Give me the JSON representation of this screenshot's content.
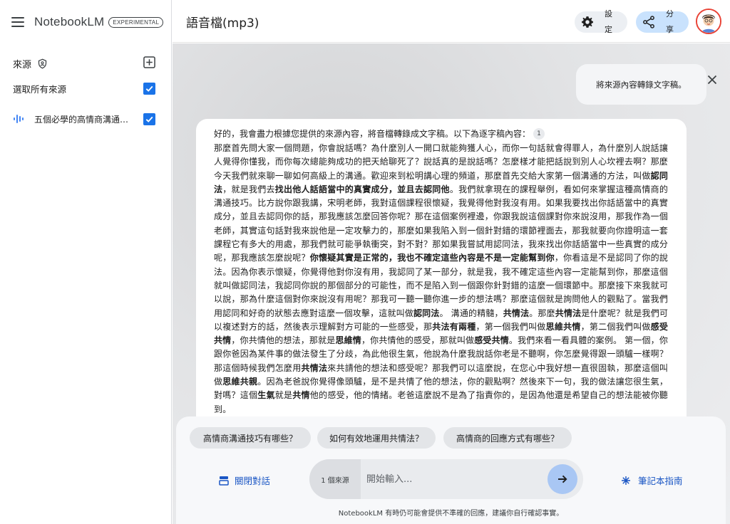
{
  "app": {
    "name": "NotebookLM",
    "badge": "EXPERIMENTAL"
  },
  "sidebar": {
    "sources_title": "來源",
    "select_all_label": "選取所有來源",
    "select_all_checked": true,
    "items": [
      {
        "icon": "audio-icon",
        "label": "五個必學的高情商溝通技巧",
        "checked": true
      }
    ]
  },
  "header": {
    "notebook_title": "語音檔(mp3)",
    "settings_label": "設定",
    "share_label": "分享"
  },
  "chat": {
    "user_message": "將來源內容轉錄文字稿。",
    "reply_intro": "好的，我會盡力根據您提供的來源內容，將音檔轉錄成文字稿。以下為逐字稿內容：",
    "citation": "1",
    "reply_segments": [
      {
        "t": "那麼首先問大家一個問題，你會說話嗎？為什麼別人一開口就能夠獲人心，而你一句話就會得罪人，為什麼別人說話讓人覺得你懂我，而你每次總能夠成功的把天給聊死了？說話真的是說話嗎？怎麼樣才能把話說到別人心坎裡去啊？那麼今天我們就來聊一聊如何高級上的溝通。歡迎來到松明講心理的頻道，那麼首先交給大家第一個溝通的方法，叫做",
        "b": false
      },
      {
        "t": "認同法",
        "b": true
      },
      {
        "t": "，就是我們去",
        "b": false
      },
      {
        "t": "找出他人話語當中的真實成分，並且去認同他",
        "b": true
      },
      {
        "t": "。我們就拿現在的課程舉例，看如何來掌握這種高情商的溝通技巧。比方說你跟我講，宋明老師，我對這個課程很懷疑，我覺得他對我沒有用。如果我要找出你話語當中的真實成分，並且去認同你的話，那我應該怎麼回答你呢？那在這個案例裡邊，你跟我說這個課對你來說沒用，那我作為一個老師，其實這句話對我來說他是一定攻擊力的，那麼如果我陷入到一個針對錯的環節裡面去，那我就要向你證明這一套課程它有多大的用處，那我們就可能爭執衝突，對不對？那如果我嘗試用認同法，我來找出你話語當中一些真實的成分呢，那我應該怎麼說呢？",
        "b": false
      },
      {
        "t": "你懷疑其實是正常的，我也不確定這些內容是不是一定能幫到你",
        "b": true
      },
      {
        "t": "，你看這是不是認同了你的說法。因為你表示懷疑，你覺得他對你沒有用，我認同了某一部分，就是我，我不確定這些內容一定能幫到你，那麼這個就叫做認同法，我認同你說的那個部分的可能性，而不是陷入到一個跟你針對錯的這麼一個環節中。那麼接下來我就可以說，那為什麼這個對你來說沒有用呢？那我可一聽一聽你進一步的想法嗎？那麼這個就是詢問他人的觀點了。當我們用認同和好奇的狀態去應對這麼一個攻擊，這就叫做",
        "b": false
      },
      {
        "t": "認同法",
        "b": true
      },
      {
        "t": "。 溝通的精髓，",
        "b": false
      },
      {
        "t": "共情法",
        "b": true
      },
      {
        "t": "。那麼",
        "b": false
      },
      {
        "t": "共情法",
        "b": true
      },
      {
        "t": "是什麼呢？就是我們可以複述對方的話，然後表示理解對方可能的一些感受，那",
        "b": false
      },
      {
        "t": "共法有兩種",
        "b": true
      },
      {
        "t": "，第一個我們叫做",
        "b": false
      },
      {
        "t": "思維共情",
        "b": true
      },
      {
        "t": "，第二個我們叫做",
        "b": false
      },
      {
        "t": "感受共情",
        "b": true
      },
      {
        "t": "，你共情他的想法，那就是",
        "b": false
      },
      {
        "t": "思維情",
        "b": true
      },
      {
        "t": "，你共情他的感受，那就叫做",
        "b": false
      },
      {
        "t": "感受共情",
        "b": true
      },
      {
        "t": "。我們來看一看具體的案例。 第一個，你跟你爸因為某件事的做法發生了分歧，為此他很生氣，他說為什麼我說話你老是不聽啊，你怎麼覺得跟一頭驢一樣啊？那這個時候我們怎麼用",
        "b": false
      },
      {
        "t": "共情法",
        "b": true
      },
      {
        "t": "來共請他的想法和感受呢？那我們可以這麼說，在您心中我好想一直很固執，那麼這個叫做",
        "b": false
      },
      {
        "t": "思維共親",
        "b": true
      },
      {
        "t": "。因為老爸說你覺得像頭驢，是不是共情了他的想法，你的觀點啊？然後來下一句，我的做法讓您很生氣，對嗎？這個",
        "b": false
      },
      {
        "t": "生氣",
        "b": true
      },
      {
        "t": "就是",
        "b": false
      },
      {
        "t": "共情",
        "b": true
      },
      {
        "t": "他的感受，他的情緒。老爸這麼說不是為了指責你的，是因為他還是希望自己的想法能被你聽到。",
        "b": false
      }
    ]
  },
  "composer": {
    "suggestions": [
      "高情商溝通技巧有哪些？",
      "如何有效地運用共情法？",
      "高情商的回應方式有哪些？"
    ],
    "close_chat_label": "關閉對話",
    "source_count": "1 個來源",
    "placeholder": "開始輸入...",
    "guide_label": "筆記本指南",
    "disclaimer": "NotebookLM 有時仍可能會提供不準確的回應，建議你自行確認事實。"
  },
  "colors": {
    "accent": "#1a73e8",
    "link": "#1a56c4",
    "share_bg": "#c9e2fd",
    "send_bg": "#a9c7f4",
    "avatar_ring": "#e94235"
  }
}
